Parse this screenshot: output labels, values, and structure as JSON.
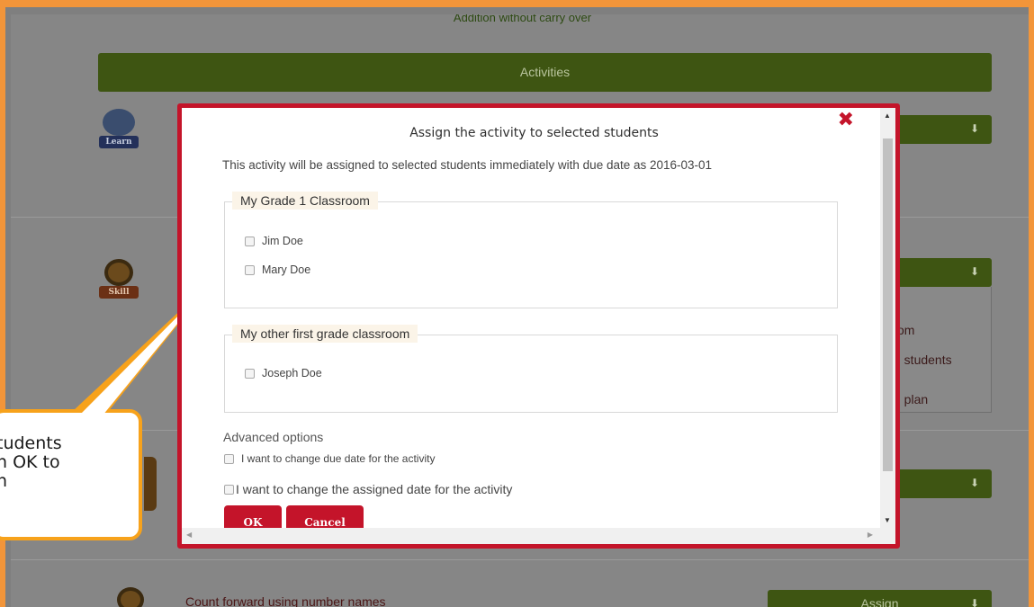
{
  "background": {
    "top_text": "Addition without carry over",
    "activities_label": "Activities",
    "learn_badge": "Learn",
    "skill_badge": "Skill",
    "dropdown_items": [
      "om",
      "d students",
      "n plan"
    ],
    "count_link": "Count forward using number names",
    "assign_label": "Assign",
    "arrow_glyph": "⬇"
  },
  "callout": {
    "text": "tudents\nn OK to\nn"
  },
  "modal": {
    "close_glyph": "✖",
    "title": "Assign the activity to selected students",
    "description": "This activity will be assigned to selected students immediately with due date as 2016-03-01",
    "groups": [
      {
        "name": "My Grade 1 Classroom",
        "students": [
          "Jim Doe",
          "Mary Doe"
        ]
      },
      {
        "name": "My other first grade classroom",
        "students": [
          "Joseph Doe"
        ]
      }
    ],
    "advanced_label": "Advanced options",
    "option_due_date": "I want to change due date for the activity",
    "option_assigned_date": "I want to change the assigned date for the activity",
    "ok_label": "OK",
    "cancel_label": "Cancel"
  },
  "colors": {
    "frame": "#f2953a",
    "modal_border": "#c4142a",
    "green": "#3e5512",
    "callout_border": "#f7a21b"
  }
}
